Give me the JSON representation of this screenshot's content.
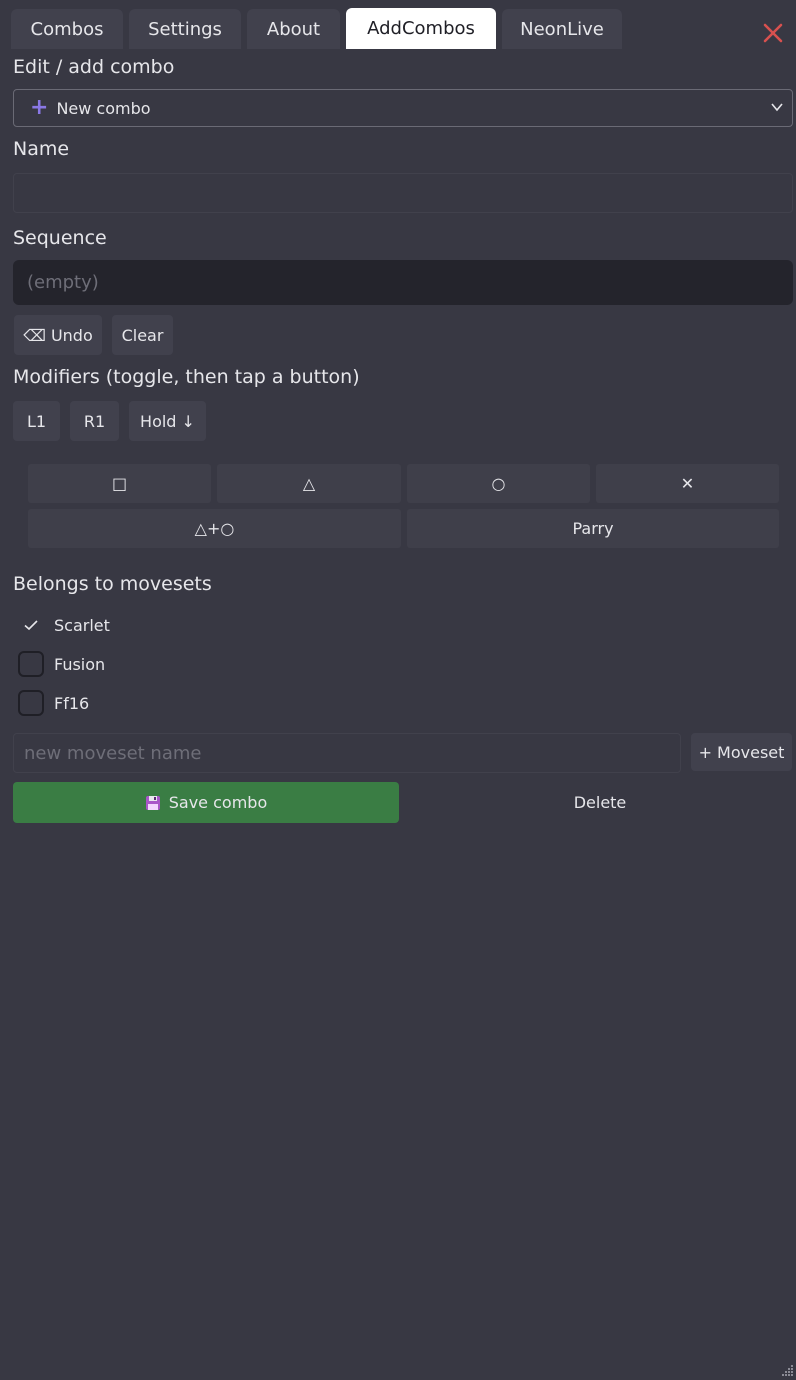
{
  "tabs": [
    {
      "label": "Combos"
    },
    {
      "label": "Settings"
    },
    {
      "label": "About"
    },
    {
      "label": "AddCombos",
      "active": true
    },
    {
      "label": "NeonLive"
    }
  ],
  "colors": {
    "accent_plus": "#8a78e6",
    "close": "#d8514f",
    "save": "#3a7d44"
  },
  "edit": {
    "heading": "Edit / add combo",
    "selected_combo": "New combo",
    "selected_icon": "plus-icon"
  },
  "name": {
    "label": "Name",
    "value": ""
  },
  "sequence": {
    "label": "Sequence",
    "placeholder": "(empty)",
    "undo_label": "⌫ Undo",
    "clear_label": "Clear"
  },
  "modifiers": {
    "label": "Modifiers (toggle, then tap a button)",
    "buttons": [
      "L1",
      "R1",
      "Hold ↓"
    ]
  },
  "pad": {
    "row1": [
      "□",
      "△",
      "○",
      "✕"
    ],
    "row2": [
      "△+○",
      "Parry"
    ]
  },
  "movesets": {
    "label": "Belongs to movesets",
    "items": [
      {
        "name": "Scarlet",
        "checked": true
      },
      {
        "name": "Fusion",
        "checked": false
      },
      {
        "name": "Ff16",
        "checked": false
      }
    ],
    "new_placeholder": "new moveset name",
    "add_label": "+ Moveset"
  },
  "actions": {
    "save_label": "Save combo",
    "delete_label": "Delete"
  }
}
